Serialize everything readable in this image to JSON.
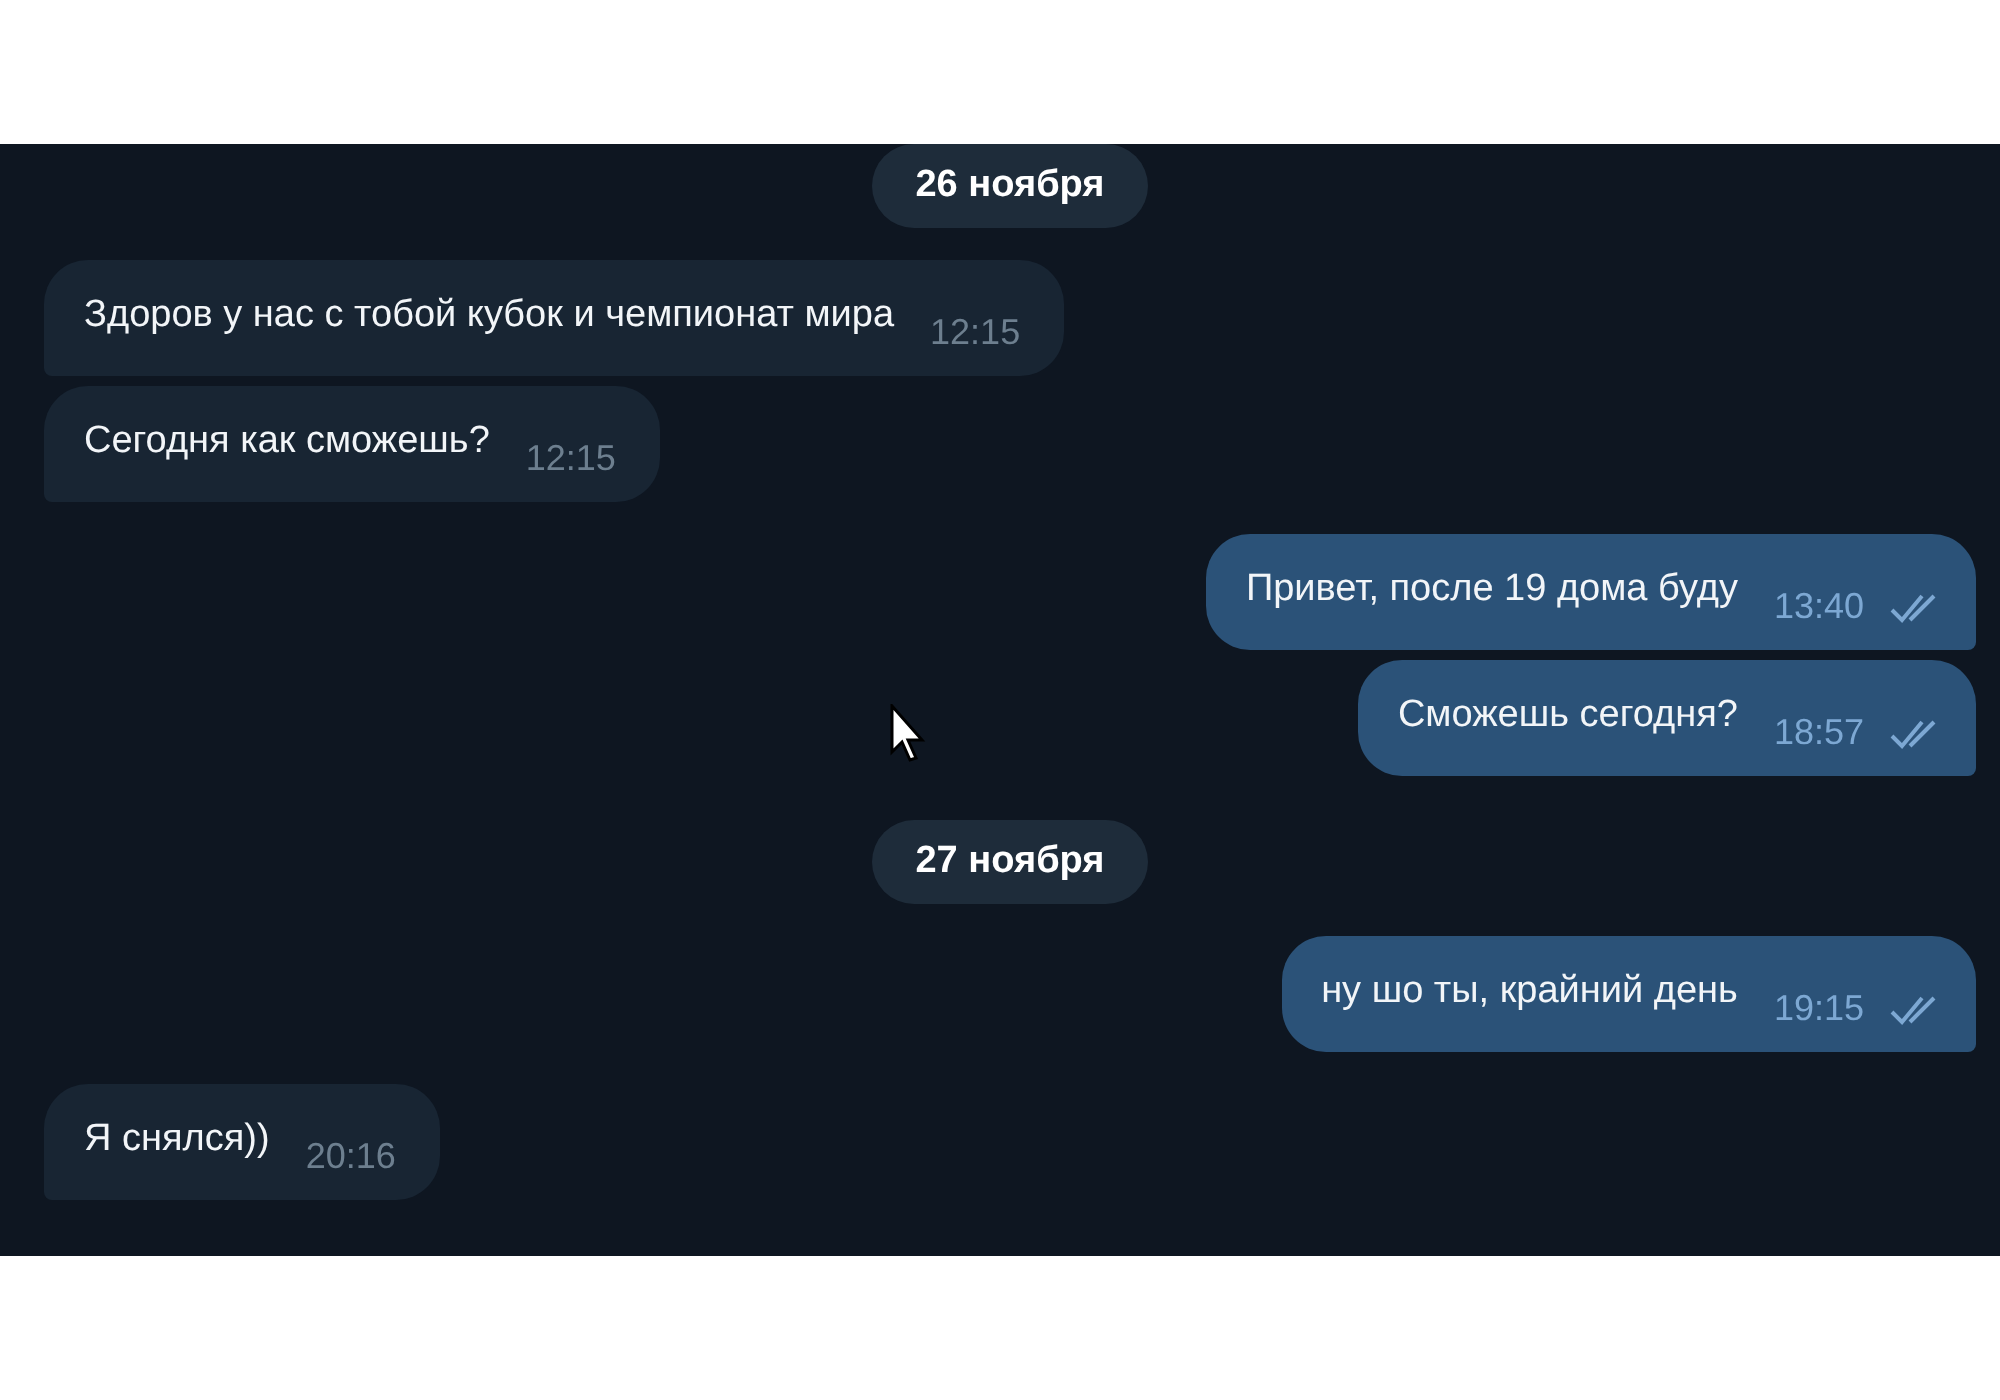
{
  "messages": [
    {
      "kind": "date",
      "text": "26 ноября"
    },
    {
      "kind": "incoming",
      "text": "Здоров у нас с тобой кубок и чемпионат мира",
      "time": "12:15"
    },
    {
      "kind": "incoming",
      "text": "Сегодня как сможешь?",
      "time": "12:15"
    },
    {
      "kind": "outgoing",
      "text": "Привет, после 19 дома буду",
      "time": "13:40",
      "read": true
    },
    {
      "kind": "outgoing",
      "text": "Сможешь сегодня?",
      "time": "18:57",
      "read": true
    },
    {
      "kind": "date",
      "text": "27 ноября"
    },
    {
      "kind": "outgoing",
      "text": "ну шо ты, крайний день",
      "time": "19:15",
      "read": true
    },
    {
      "kind": "incoming",
      "text": "Я снялся))",
      "time": "20:16"
    }
  ]
}
